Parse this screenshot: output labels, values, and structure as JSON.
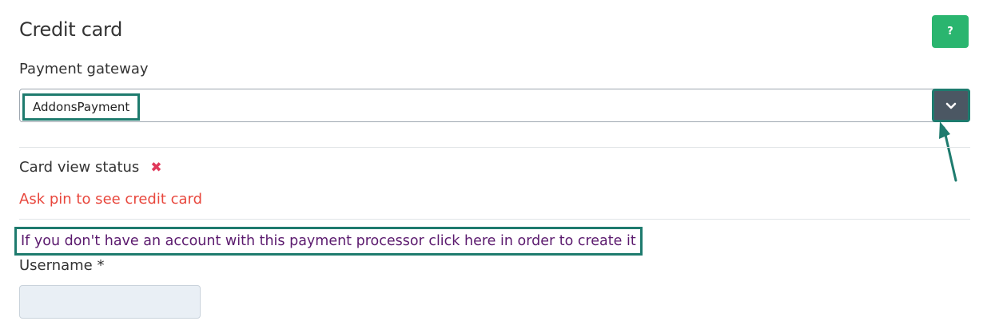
{
  "section": {
    "title": "Credit card",
    "help_label": "?"
  },
  "gateway": {
    "label": "Payment gateway",
    "selected": "AddonsPayment"
  },
  "card_view": {
    "label": "Card view status",
    "status_icon": "x-icon",
    "message": "Ask pin to see credit card"
  },
  "create_link": {
    "text": "If you don't have an account with this payment processor click here in order to create it"
  },
  "username": {
    "label": "Username  *",
    "value": "",
    "placeholder": ""
  },
  "colors": {
    "help_button": "#2ab56f",
    "highlight": "#1e7b6e",
    "error": "#e8473d",
    "link": "#5b1a6e",
    "status_x": "#e0395b"
  }
}
